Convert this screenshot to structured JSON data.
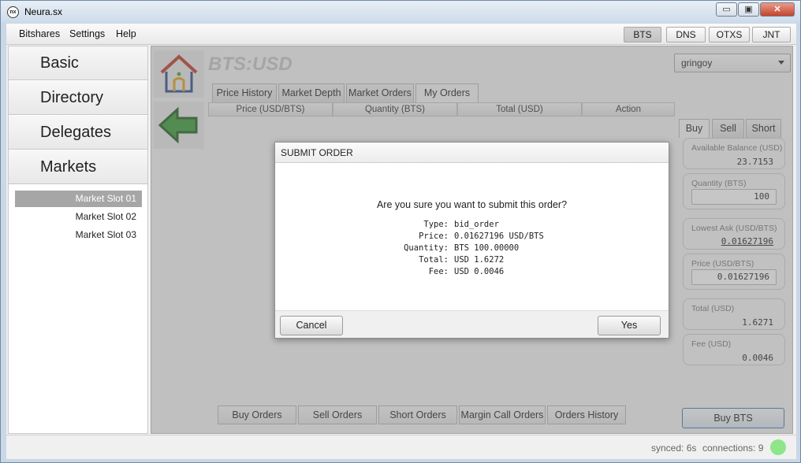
{
  "window": {
    "title": "Neura.sx",
    "icon": "neura-logo-icon"
  },
  "window_controls": {
    "minimize": "▭",
    "maximize": "▣",
    "close": "✕"
  },
  "menubar": {
    "items": [
      "Bitshares",
      "Settings",
      "Help"
    ]
  },
  "asset_buttons": [
    "BTS",
    "DNS",
    "OTXS",
    "JNT"
  ],
  "sidebar": {
    "nav": [
      "Basic",
      "Directory",
      "Delegates",
      "Markets"
    ],
    "slots": [
      "Market Slot 01",
      "Market Slot 02",
      "Market Slot 03"
    ]
  },
  "market": {
    "pair": "BTS:USD",
    "account": "gringoy",
    "tabs": [
      "Price History",
      "Market Depth",
      "Market Orders",
      "My Orders"
    ],
    "columns": [
      "Price (USD/BTS)",
      "Quantity (BTS)",
      "Total (USD)",
      "Action"
    ],
    "order_tabs": [
      "Buy",
      "Sell",
      "Short"
    ],
    "available_balance": {
      "label": "Available Balance (USD)",
      "value": "23.7153"
    },
    "quantity": {
      "label": "Quantity (BTS)",
      "value": "100"
    },
    "lowest_ask": {
      "label": "Lowest Ask (USD/BTS)",
      "value": "0.01627196"
    },
    "price": {
      "label": "Price (USD/BTS)",
      "value": "0.01627196"
    },
    "total": {
      "label": "Total (USD)",
      "value": "1.6271"
    },
    "fee": {
      "label": "Fee (USD)",
      "value": "0.0046"
    },
    "bottom_tabs": [
      "Buy Orders",
      "Sell Orders",
      "Short Orders",
      "Margin Call Orders",
      "Orders History"
    ],
    "buy_button": "Buy BTS"
  },
  "status": {
    "synced": "synced: 6s",
    "connections": "connections: 9",
    "indicator_color": "#8ee58a"
  },
  "dialog": {
    "title": "SUBMIT ORDER",
    "question": "Are you sure you want to submit this order?",
    "rows": [
      {
        "k": "Type:",
        "v": "bid_order"
      },
      {
        "k": "Price:",
        "v": "0.01627196 USD/BTS"
      },
      {
        "k": "Quantity:",
        "v": "BTS 100.00000"
      },
      {
        "k": "Total:",
        "v": "USD 1.6272"
      },
      {
        "k": "Fee:",
        "v": "USD 0.0046"
      }
    ],
    "cancel": "Cancel",
    "yes": "Yes"
  }
}
